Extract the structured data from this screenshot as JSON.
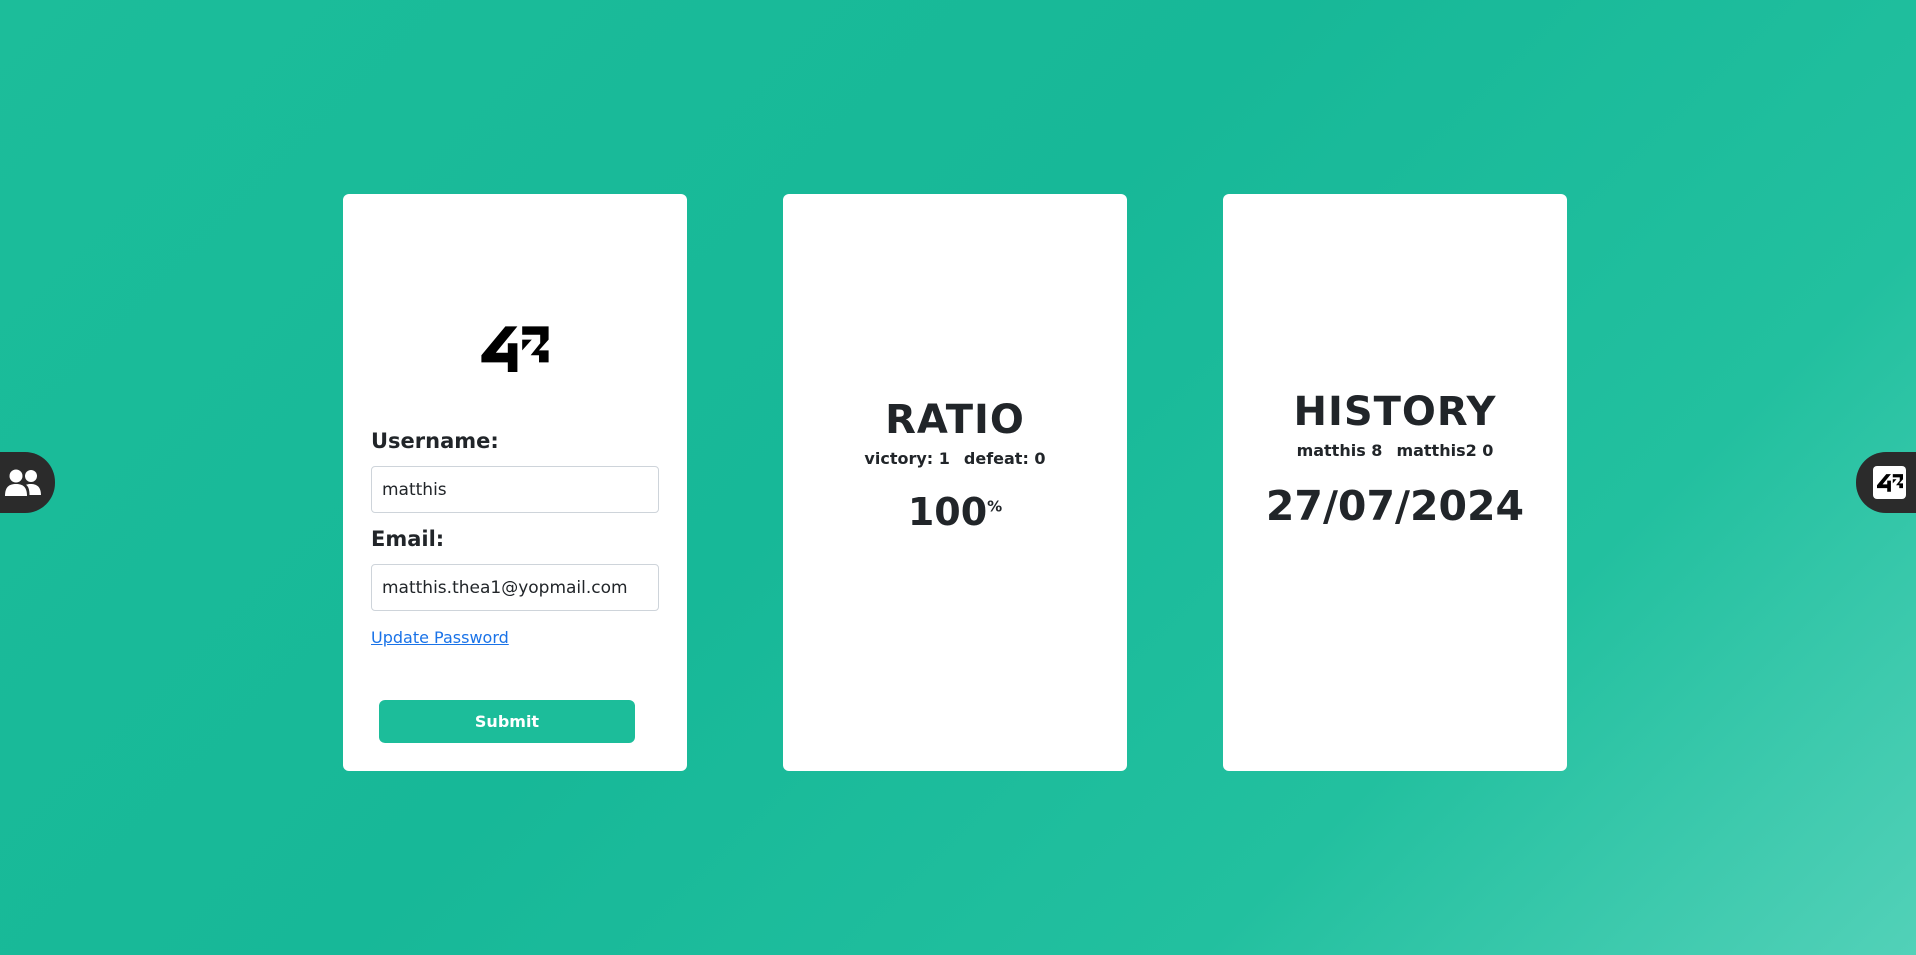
{
  "profile": {
    "username_label": "Username:",
    "username_value": "matthis",
    "email_label": "Email:",
    "email_value": "matthis.thea1@yopmail.com",
    "update_password_link": "Update Password",
    "submit_label": "Submit"
  },
  "ratio": {
    "title": "RATIO",
    "victory": "victory: 1",
    "defeat": "defeat: 0",
    "percent_value": "100",
    "percent_sign": "%"
  },
  "history": {
    "title": "HISTORY",
    "player1": "matthis 8",
    "player2": "matthis2 0",
    "date": "27/07/2024"
  },
  "icons": {
    "logo": "42-logo-icon",
    "left_tab": "users-icon",
    "right_tab": "42-logo-icon"
  },
  "colors": {
    "accent": "#1cbd9a",
    "tab_bg": "#2b2b2b",
    "link": "#1a73e8"
  }
}
